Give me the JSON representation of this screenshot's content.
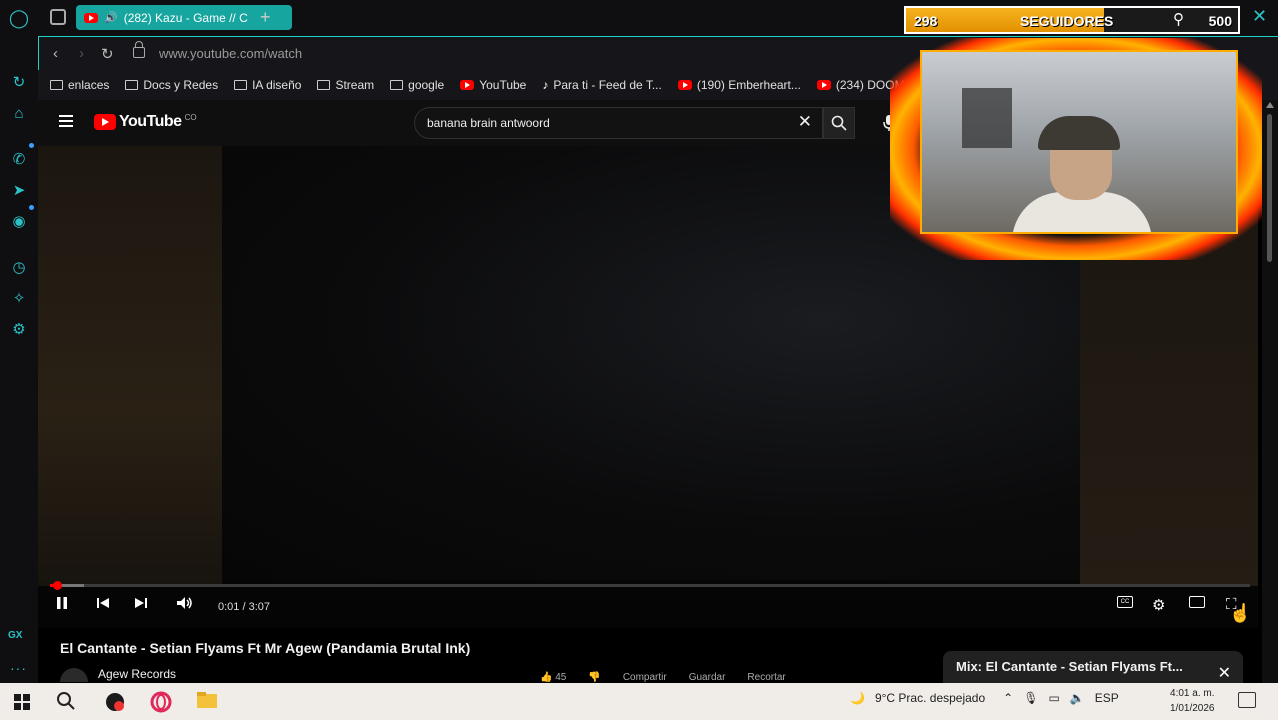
{
  "browser": {
    "tab_title": "(282) Kazu - Game // C",
    "url": "www.youtube.com/watch",
    "bookmarks": [
      {
        "label": "enlaces",
        "icon": "folder-icon"
      },
      {
        "label": "Docs y Redes",
        "icon": "folder-icon"
      },
      {
        "label": "IA diseño",
        "icon": "folder-icon"
      },
      {
        "label": "Stream",
        "icon": "folder-icon"
      },
      {
        "label": "google",
        "icon": "folder-icon"
      },
      {
        "label": "YouTube",
        "icon": "youtube-icon"
      },
      {
        "label": "Para ti - Feed de T...",
        "icon": "tiktok-icon"
      },
      {
        "label": "(190) Emberheart...",
        "icon": "youtube-icon"
      },
      {
        "label": "(234) DOOM",
        "icon": "youtube-icon"
      }
    ],
    "sidebar_label": "GX"
  },
  "youtube": {
    "logo_text": "YouTube",
    "logo_country": "CO",
    "search_value": "banana brain antwoord",
    "player": {
      "time": "0:01 / 3:07",
      "progress_played": 0.006,
      "progress_buffered": 0.028
    },
    "video_title": "El Cantante - Setian Flyams Ft Mr Agew (Pandamia Brutal Ink)",
    "channel": "Agew Records",
    "actions": [
      "45",
      "",
      "Compartir",
      "Guardar",
      "Recortar"
    ],
    "mix_title": "Mix: El Cantante - Setian Flyams Ft..."
  },
  "stream_overlay": {
    "followers": "298",
    "label": "SEGUIDORES",
    "goal": "500",
    "progress": 0.596
  },
  "taskbar": {
    "weather": "9°C  Prac. despejado",
    "language": "ESP",
    "time": "4:01 a. m.",
    "date": "1/01/2026"
  },
  "colors": {
    "accent": "#17a59f",
    "youtube_red": "#ff0000",
    "overlay_gold": "#f7b21e"
  }
}
